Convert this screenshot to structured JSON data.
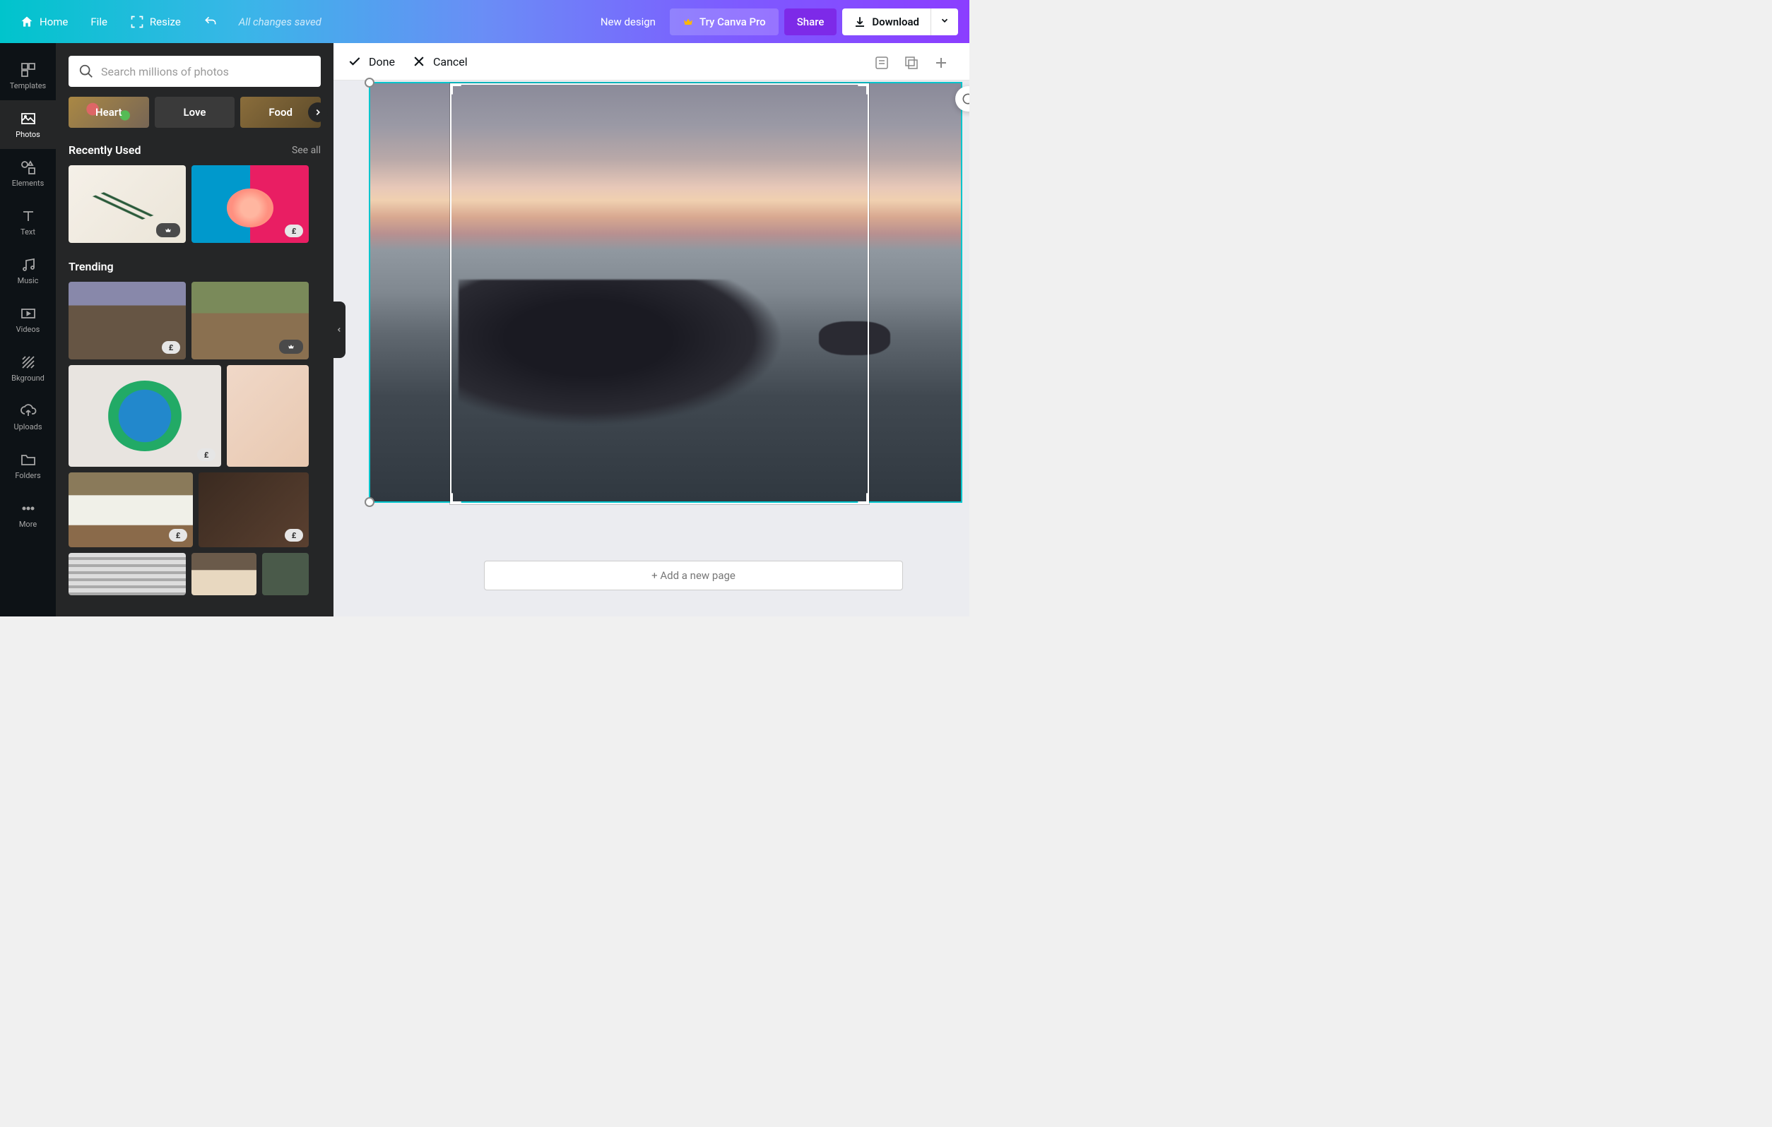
{
  "topbar": {
    "home": "Home",
    "file": "File",
    "resize": "Resize",
    "saved_status": "All changes saved",
    "new_design": "New design",
    "try_pro": "Try Canva Pro",
    "share": "Share",
    "download": "Download"
  },
  "rail": {
    "items": [
      {
        "label": "Templates",
        "icon": "templates"
      },
      {
        "label": "Photos",
        "icon": "photos"
      },
      {
        "label": "Elements",
        "icon": "elements"
      },
      {
        "label": "Text",
        "icon": "text"
      },
      {
        "label": "Music",
        "icon": "music"
      },
      {
        "label": "Videos",
        "icon": "videos"
      },
      {
        "label": "Bkground",
        "icon": "background"
      },
      {
        "label": "Uploads",
        "icon": "uploads"
      },
      {
        "label": "Folders",
        "icon": "folders"
      },
      {
        "label": "More",
        "icon": "more"
      }
    ],
    "active_index": 1
  },
  "panel": {
    "search_placeholder": "Search millions of photos",
    "chips": [
      "Heart",
      "Love",
      "Food"
    ],
    "recently_used": {
      "title": "Recently Used",
      "see_all": "See all",
      "items": [
        {
          "name": "palm-leaf-hand",
          "badge": "crown"
        },
        {
          "name": "woman-flowers",
          "badge": "pound"
        }
      ]
    },
    "trending": {
      "title": "Trending",
      "items": [
        {
          "name": "man-cooking",
          "badge": "pound"
        },
        {
          "name": "friends-dining",
          "badge": "crown"
        },
        {
          "name": "hands-globe",
          "badge": "pound"
        },
        {
          "name": "girl-dancing",
          "badge": null
        },
        {
          "name": "kitchen-sink",
          "badge": "pound"
        },
        {
          "name": "fireplace",
          "badge": "pound"
        },
        {
          "name": "person-blinds",
          "badge": null
        },
        {
          "name": "barista",
          "badge": null
        },
        {
          "name": "lady-plants",
          "badge": null
        }
      ]
    }
  },
  "editbar": {
    "done": "Done",
    "cancel": "Cancel"
  },
  "canvas": {
    "add_page": "+ Add a new page"
  },
  "badge_symbols": {
    "pound": "£"
  }
}
